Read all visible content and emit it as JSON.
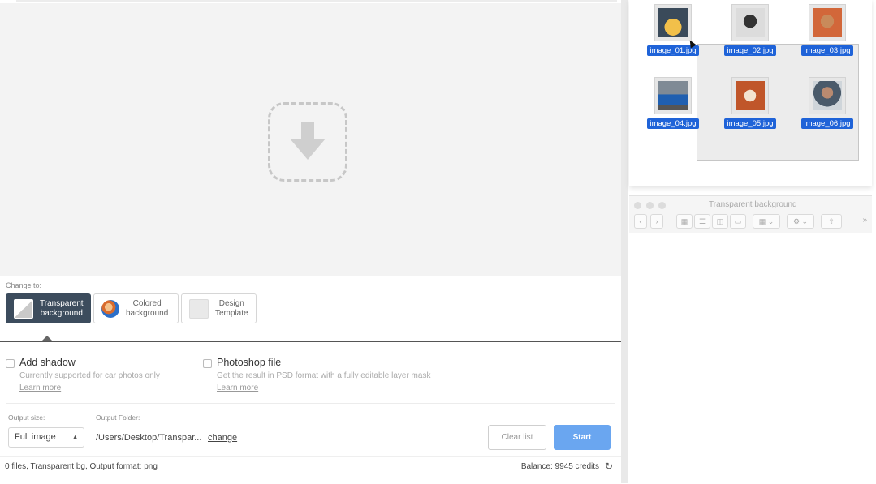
{
  "app": {
    "change_to_label": "Change to:",
    "modes": [
      {
        "label": "Transparent\nbackground",
        "icon": "transparent-icon",
        "active": true
      },
      {
        "label": "Colored\nbackground",
        "icon": "colored-icon",
        "active": false
      },
      {
        "label": "Design\nTemplate",
        "icon": "design-template-icon",
        "active": false
      }
    ],
    "options": {
      "shadow": {
        "title": "Add shadow",
        "desc": "Currently supported for car photos only",
        "learn_more": "Learn more"
      },
      "photoshop": {
        "title": "Photoshop file",
        "desc": "Get the result in PSD format with a fully editable layer mask",
        "learn_more": "Learn more"
      }
    },
    "output_size": {
      "label": "Output size:",
      "value": "Full image"
    },
    "output_folder": {
      "label": "Output Folder:",
      "path": "/Users/Desktop/Transpar...",
      "change_label": "change"
    },
    "buttons": {
      "clear": "Clear list",
      "start": "Start"
    },
    "status": {
      "summary": "0 files, Transparent bg, Output format: png",
      "balance": "Balance: 9945 credits"
    },
    "colors": {
      "active_mode": "#3c4c5d",
      "start_button": "#6aa6f0",
      "selection": "#1f63d8"
    }
  },
  "finder": {
    "files": [
      "image_01.jpg",
      "image_02.jpg",
      "image_03.jpg",
      "image_04.jpg",
      "image_05.jpg",
      "image_06.jpg"
    ],
    "window_title": "Transparent background",
    "toolbar_icons": [
      "back-icon",
      "forward-icon",
      "grid-view-icon",
      "list-view-icon",
      "column-view-icon",
      "gallery-view-icon",
      "group-icon",
      "gear-icon",
      "share-icon",
      "more-icon"
    ]
  }
}
